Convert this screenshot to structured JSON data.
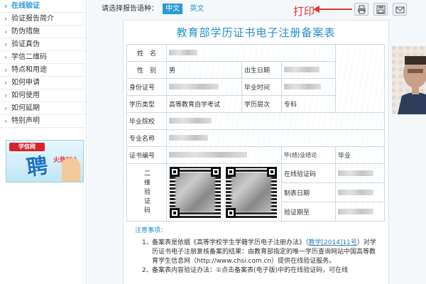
{
  "sidebar": {
    "items": [
      {
        "label": "在线验证",
        "active": true
      },
      {
        "label": "验证报告简介"
      },
      {
        "label": "防伪措施"
      },
      {
        "label": "验证真伪"
      },
      {
        "label": "学信二维码"
      },
      {
        "label": "特点和用途"
      },
      {
        "label": "如何申请"
      },
      {
        "label": "如何使用"
      },
      {
        "label": "如何延期"
      },
      {
        "label": "特别声明"
      }
    ],
    "banner": {
      "logo": "学信网",
      "big": "聘",
      "small": "火热加入"
    }
  },
  "header": {
    "lang_prompt": "请选择报告语种：",
    "lang_zh": "中文",
    "lang_en": "英文",
    "print_note": "打印",
    "tools": [
      "print-icon",
      "save-icon",
      "email-icon"
    ]
  },
  "doc": {
    "title": "教育部学历证书电子注册备案表",
    "labels": {
      "name": "姓　名",
      "gender": "性　别",
      "birth": "出生日期",
      "id_no": "身份证号",
      "grad_time": "毕业时间",
      "edu_type": "学历类型",
      "edu_level": "学历层次",
      "school": "毕业院校",
      "major": "专业名称",
      "cert_no": "证书编号",
      "conclusion": "毕(结)业结论",
      "qr": "二维验证码",
      "online_code": "在线验证码",
      "made_date": "制表日期",
      "valid": "验证期至"
    },
    "values": {
      "gender": "男",
      "edu_type": "高等教育自学考试",
      "edu_level": "专科",
      "conclusion": "毕业"
    }
  },
  "notes": {
    "title": "注意事项：",
    "item1_num": "1、",
    "item1_a": "备案表是依据《高等学校学生学籍学历电子注册办法》（",
    "item1_link": "教学[2014]11号",
    "item1_b": "）对学历证书电子注册复核备案的结果：由教育部指定的唯一学历查询网站中国高等教育学生信息网（http://www.chsi.com.cn）提供在线验证服务。",
    "item2_num": "2、",
    "item2": "备案表内容验证办法：①点击备案表(电子版)中的在线验证码，可在线"
  },
  "colors": {
    "accent": "#2a9ad6",
    "title": "#1f8fcf",
    "annotation": "#e3352c"
  }
}
